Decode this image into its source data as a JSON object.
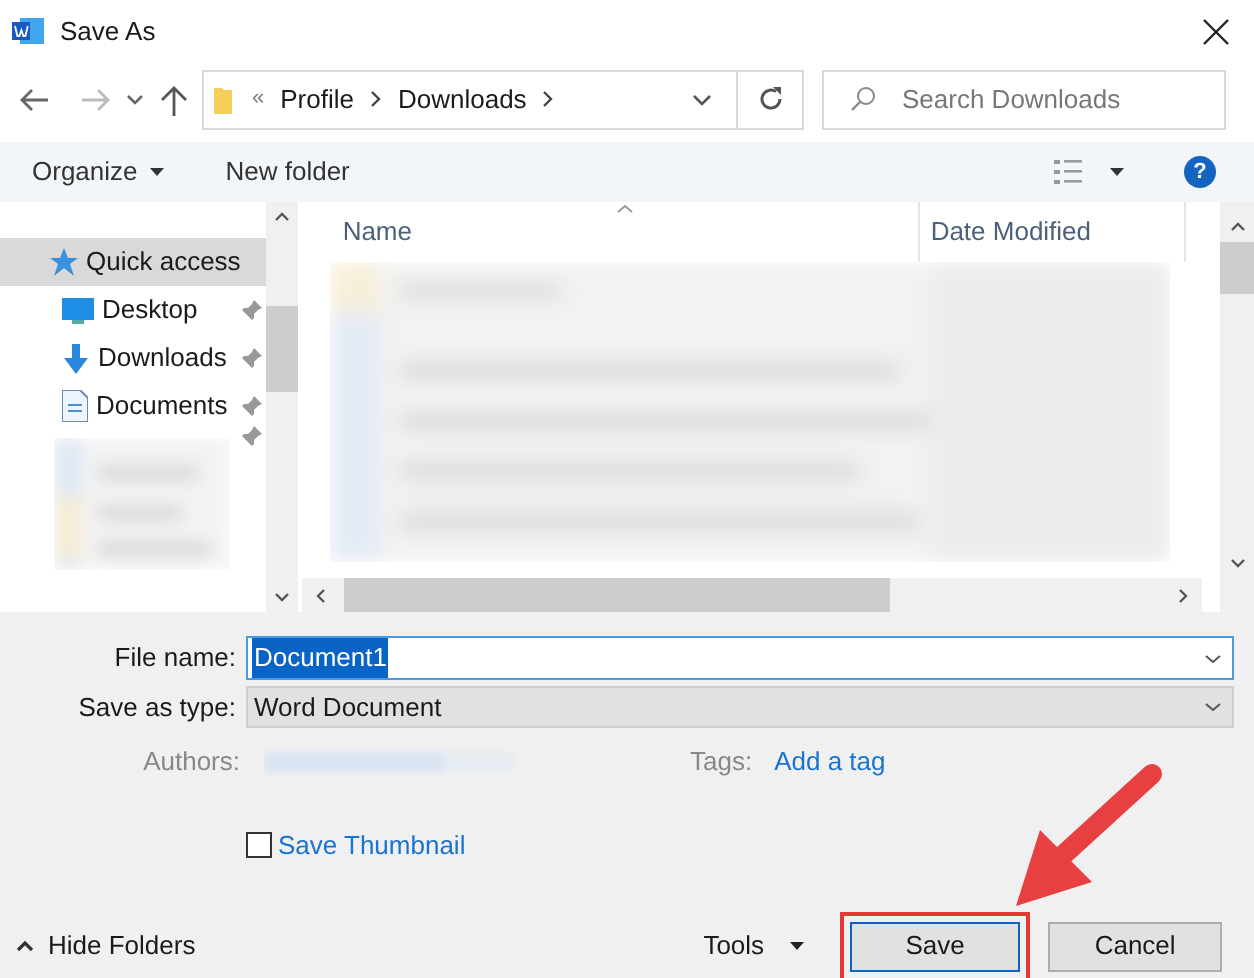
{
  "window": {
    "title": "Save As"
  },
  "address": {
    "separator": "«",
    "crumbs": [
      "Profile",
      "Downloads"
    ]
  },
  "search": {
    "placeholder": "Search Downloads"
  },
  "toolbar": {
    "organize": "Organize",
    "new_folder": "New folder",
    "help": "?"
  },
  "sidebar": {
    "items": [
      {
        "label": "Quick access",
        "selected": true,
        "pinned": false
      },
      {
        "label": "Desktop",
        "selected": false,
        "pinned": true
      },
      {
        "label": "Downloads",
        "selected": false,
        "pinned": true
      },
      {
        "label": "Documents",
        "selected": false,
        "pinned": true
      }
    ]
  },
  "file_list": {
    "columns": [
      "Name",
      "Date Modified"
    ]
  },
  "form": {
    "file_name_label": "File name:",
    "file_name": "Document1",
    "type_label": "Save as type:",
    "type": "Word Document",
    "authors_label": "Authors:",
    "tags_label": "Tags:",
    "tags_link": "Add a tag",
    "thumbnail": {
      "label": "Save Thumbnail",
      "checked": false
    }
  },
  "footer": {
    "hide_folders": "Hide Folders",
    "tools": "Tools",
    "save": "Save",
    "cancel": "Cancel"
  }
}
